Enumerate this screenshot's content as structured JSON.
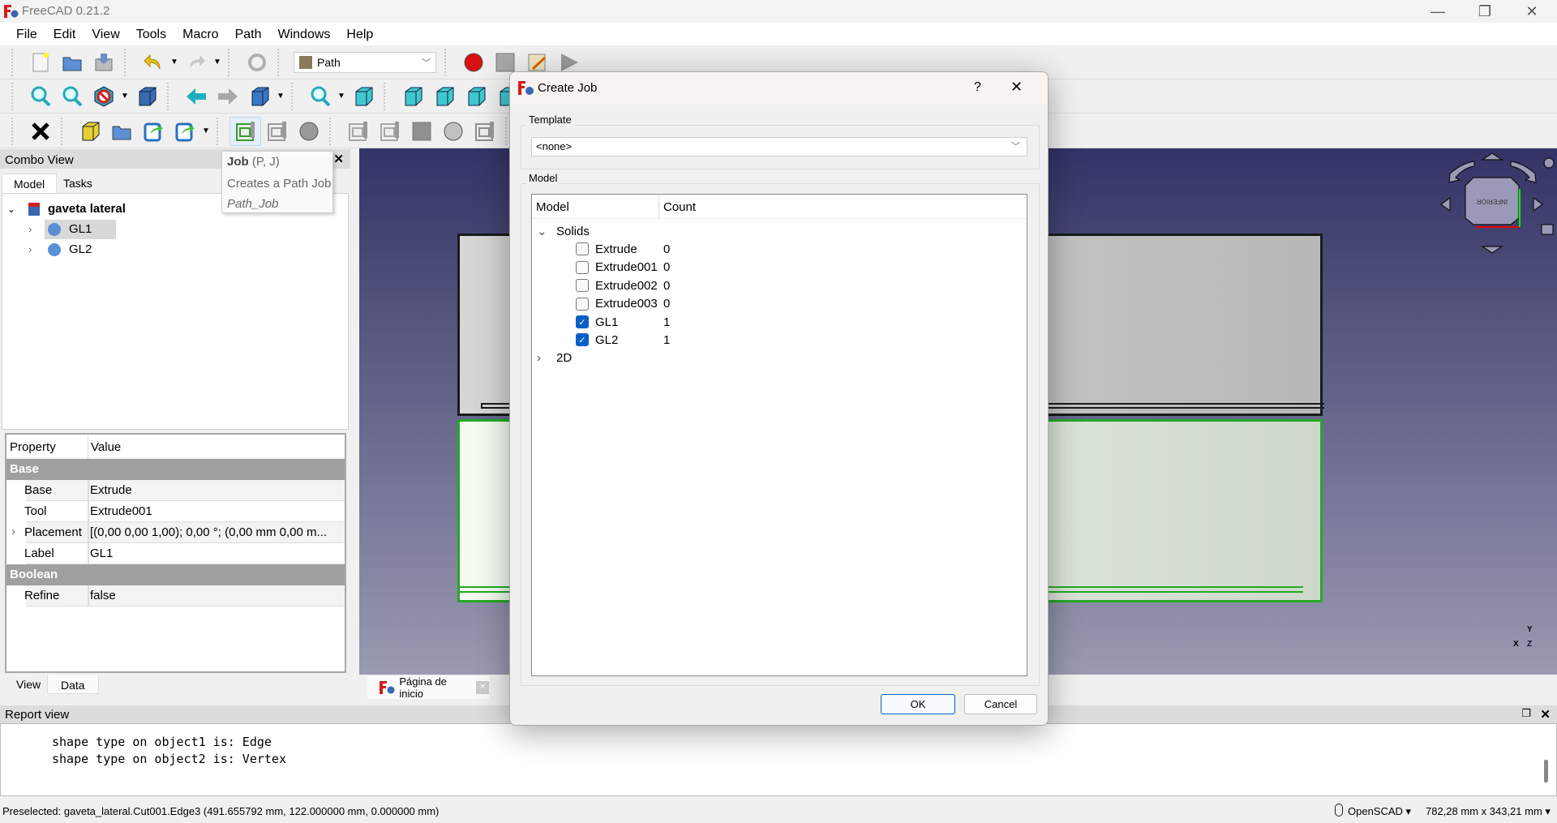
{
  "window": {
    "title": "FreeCAD 0.21.2",
    "minimize": "—",
    "restore": "❐",
    "close": "✕"
  },
  "menu": [
    "File",
    "Edit",
    "View",
    "Tools",
    "Macro",
    "Path",
    "Windows",
    "Help"
  ],
  "workbench": {
    "value": "Path",
    "chevron": "﹀"
  },
  "toolbars": [
    [
      {
        "t": "sep"
      },
      {
        "i": "new-document-icon",
        "s": "doc",
        "c": "#f4f4f4"
      },
      {
        "i": "open-document-icon",
        "s": "folder",
        "c": "#5b8fd6"
      },
      {
        "i": "save-document-icon",
        "s": "save",
        "c": "#6b8fc6"
      },
      {
        "t": "sep"
      },
      {
        "i": "undo-icon",
        "s": "undo",
        "c": "#e8c020"
      },
      {
        "t": "dd"
      },
      {
        "i": "redo-icon",
        "s": "redo",
        "c": "#c8c8c8"
      },
      {
        "t": "dd"
      },
      {
        "t": "sep"
      },
      {
        "i": "refresh-icon",
        "s": "refresh",
        "c": "#b0b0b0"
      },
      {
        "t": "sep"
      },
      {
        "t": "combo"
      },
      {
        "t": "sep"
      },
      {
        "i": "record-macro-icon",
        "s": "circle",
        "c": "#d81010"
      },
      {
        "i": "stop-macro-icon",
        "s": "square",
        "c": "#a8a8a8"
      },
      {
        "i": "macros-icon",
        "s": "note",
        "c": "#f0e8c0"
      },
      {
        "i": "execute-macro-icon",
        "s": "play",
        "c": "#9a9a9a"
      }
    ],
    [
      {
        "t": "sep"
      },
      {
        "i": "fit-all-icon",
        "s": "mag",
        "c": "#2aa8b8"
      },
      {
        "i": "fit-selection-icon",
        "s": "mag",
        "c": "#2aa8b8"
      },
      {
        "i": "draw-style-icon",
        "s": "nohex",
        "c": "#d02020"
      },
      {
        "t": "dd"
      },
      {
        "i": "bounding-box-icon",
        "s": "cube",
        "c": "#3a6ab0"
      },
      {
        "t": "sep"
      },
      {
        "i": "back-icon",
        "s": "left",
        "c": "#20b0c0"
      },
      {
        "i": "forward-icon",
        "s": "right",
        "c": "#a8a8a8"
      },
      {
        "i": "standard-views-icon",
        "s": "cube",
        "c": "#3a78c8"
      },
      {
        "t": "dd"
      },
      {
        "t": "sep"
      },
      {
        "i": "sync-view-icon",
        "s": "mag",
        "c": "#2aa8b8"
      },
      {
        "t": "dd"
      },
      {
        "i": "isometric-view-icon",
        "s": "cube",
        "c": "#40c8d0"
      },
      {
        "t": "sep"
      },
      {
        "i": "front-view-icon",
        "s": "cube",
        "c": "#40c8d0"
      },
      {
        "i": "top-view-icon",
        "s": "cube",
        "c": "#40c8d0"
      },
      {
        "i": "right-view-icon",
        "s": "cube",
        "c": "#40c8d0"
      },
      {
        "i": "rear-view-icon",
        "s": "cube",
        "c": "#40c8d0"
      },
      {
        "i": "bottom-view-icon",
        "s": "cube",
        "c": "#40c8d0"
      }
    ],
    [
      {
        "t": "sep"
      },
      {
        "i": "close-x-icon",
        "s": "x",
        "c": "#000000"
      },
      {
        "t": "sep"
      },
      {
        "i": "create-part-icon",
        "s": "cube",
        "c": "#e8d030"
      },
      {
        "i": "create-group-icon",
        "s": "folder",
        "c": "#5b8fd6"
      },
      {
        "i": "make-link-icon",
        "s": "link",
        "c": "#2a70c0"
      },
      {
        "i": "link-actions-icon",
        "s": "link",
        "c": "#2a70c0"
      },
      {
        "t": "dd"
      },
      {
        "t": "sep"
      },
      {
        "i": "path-job-icon",
        "s": "job",
        "c": "#3a9a30",
        "hl": true
      },
      {
        "i": "post-process-icon",
        "s": "job",
        "c": "#9a9a9a"
      },
      {
        "i": "inspect-icon",
        "s": "circle",
        "c": "#9a9a9a"
      },
      {
        "t": "sep"
      },
      {
        "i": "tool-bit-icon",
        "s": "job",
        "c": "#a8a8a8"
      },
      {
        "i": "tool-controller-icon",
        "s": "job",
        "c": "#a8a8a8"
      },
      {
        "i": "stock-icon",
        "s": "square",
        "c": "#909090"
      },
      {
        "i": "tool-library-icon",
        "s": "circle",
        "c": "#c0c0c0"
      },
      {
        "i": "drills-icon",
        "s": "job",
        "c": "#909090"
      },
      {
        "t": "sep"
      },
      {
        "i": "profile-icon",
        "s": "job",
        "c": "#909090"
      }
    ]
  ],
  "tooltip": {
    "title": "Job",
    "shortcut": "(P, J)",
    "desc": "Creates a Path Job",
    "cmd": "Path_Job"
  },
  "combo_view": {
    "title": "Combo View",
    "close": "✕",
    "tabs": [
      "Model",
      "Tasks"
    ],
    "tree": [
      {
        "label": "gaveta lateral",
        "expanded": true
      },
      {
        "label": "GL1",
        "selected": true
      },
      {
        "label": "GL2"
      }
    ],
    "props": {
      "headers": [
        "Property",
        "Value"
      ],
      "groups": [
        {
          "name": "Base",
          "rows": [
            [
              "Base",
              "Extrude"
            ],
            [
              "Tool",
              "Extrude001"
            ],
            [
              "Placement",
              "[(0,00 0,00 1,00); 0,00 °; (0,00 mm  0,00 m..."
            ],
            [
              "Label",
              "GL1"
            ]
          ]
        },
        {
          "name": "Boolean",
          "rows": [
            [
              "Refine",
              "false"
            ]
          ]
        }
      ]
    },
    "bottom_tabs": [
      "View",
      "Data"
    ]
  },
  "viewport": {
    "navcube_face": "INFERIOR",
    "axes": [
      "X",
      "Y",
      "Z"
    ],
    "doc_tab": "Página de inicio"
  },
  "dialog": {
    "title": "Create Job",
    "help": "?",
    "close": "✕",
    "template_label": "Template",
    "template_value": "<none>",
    "model_label": "Model",
    "columns": [
      "Model",
      "Count"
    ],
    "groups": [
      {
        "name": "Solids",
        "expanded": true,
        "items": [
          {
            "name": "Extrude",
            "count": "0",
            "checked": false
          },
          {
            "name": "Extrude001",
            "count": "0",
            "checked": false
          },
          {
            "name": "Extrude002",
            "count": "0",
            "checked": false
          },
          {
            "name": "Extrude003",
            "count": "0",
            "checked": false
          },
          {
            "name": "GL1",
            "count": "1",
            "checked": true
          },
          {
            "name": "GL2",
            "count": "1",
            "checked": true
          }
        ]
      },
      {
        "name": "2D",
        "expanded": false,
        "items": []
      }
    ],
    "ok": "OK",
    "cancel": "Cancel"
  },
  "report": {
    "title": "Report view",
    "lines": "shape type on object1 is: Edge\nshape type on object2 is: Vertex"
  },
  "status": {
    "message": "Preselected: gaveta_lateral.Cut001.Edge3 (491.655792 mm, 122.000000 mm, 0.000000 mm)",
    "nav_style": "OpenSCAD ▾",
    "dimensions": "782,28 mm x 343,21 mm ▾"
  },
  "colors": {
    "accent": "#0a5fc4",
    "selection_green": "#22aa22",
    "viewport_top": "#333366",
    "viewport_bottom": "#9a9ab2"
  }
}
